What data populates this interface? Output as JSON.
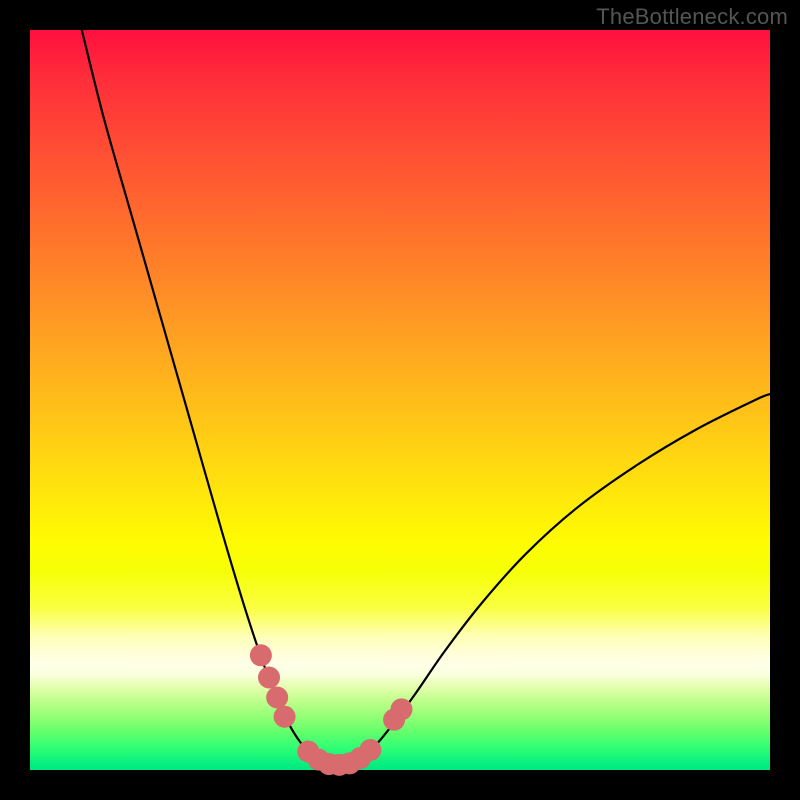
{
  "watermark": "TheBottleneck.com",
  "chart_data": {
    "type": "line",
    "title": "",
    "xlabel": "",
    "ylabel": "",
    "xlim": [
      0,
      100
    ],
    "ylim": [
      0,
      100
    ],
    "series": [
      {
        "name": "bottleneck-curve",
        "x": [
          7,
          10,
          14,
          18,
          22,
          26,
          29,
          31.5,
          33.5,
          35,
          36.5,
          38,
          39.5,
          41,
          42.5,
          44,
          46,
          48.5,
          52,
          56,
          61,
          67,
          74,
          82,
          90,
          98,
          100
        ],
        "y": [
          100,
          88,
          74,
          60,
          46,
          32,
          22,
          14.5,
          9.5,
          6.2,
          3.8,
          2.2,
          1.2,
          0.7,
          0.7,
          1.2,
          2.6,
          5.5,
          10.2,
          16,
          22.5,
          29.2,
          35.5,
          41.2,
          46,
          50,
          50.8
        ]
      }
    ],
    "markers": [
      {
        "name": "threshold-band-markers",
        "color": "#d76b6e",
        "points": [
          {
            "x": 31.2,
            "y": 15.5
          },
          {
            "x": 32.3,
            "y": 12.5
          },
          {
            "x": 33.4,
            "y": 9.8
          },
          {
            "x": 34.4,
            "y": 7.2
          },
          {
            "x": 37.6,
            "y": 2.5
          },
          {
            "x": 39.0,
            "y": 1.4
          },
          {
            "x": 40.4,
            "y": 0.8
          },
          {
            "x": 41.8,
            "y": 0.7
          },
          {
            "x": 43.2,
            "y": 0.9
          },
          {
            "x": 44.6,
            "y": 1.6
          },
          {
            "x": 46.0,
            "y": 2.7
          },
          {
            "x": 49.2,
            "y": 6.8
          },
          {
            "x": 50.2,
            "y": 8.2
          }
        ]
      }
    ],
    "gradient_stops": [
      {
        "offset": 0,
        "color": "#ff103e"
      },
      {
        "offset": 69,
        "color": "#fffb02"
      },
      {
        "offset": 85,
        "color": "#ffffe8"
      },
      {
        "offset": 100,
        "color": "#00e881"
      }
    ]
  }
}
